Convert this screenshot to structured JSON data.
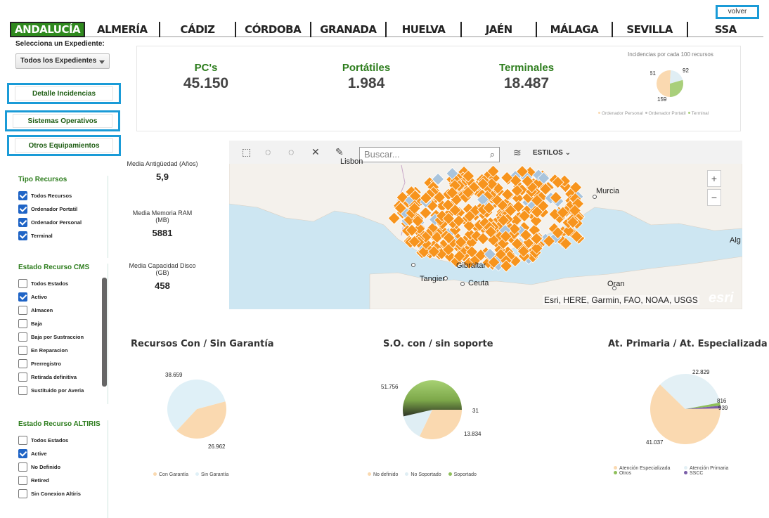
{
  "volver": "volver",
  "tabs": [
    "ANDALUCÍA",
    "ALMERÍA",
    "CÁDIZ",
    "CÓRDOBA",
    "GRANADA",
    "HUELVA",
    "JAÉN",
    "MÁLAGA",
    "SEVILLA",
    "SSA"
  ],
  "expediente": {
    "label": "Selecciona un Expediente:",
    "value": "Todos los Expedientes"
  },
  "buttons": {
    "detalle": "Detalle Incidencias",
    "sistemas": "Sistemas Operativos",
    "otros": "Otros Equipamientos"
  },
  "filters": {
    "tipo": {
      "title": "Tipo Recursos",
      "items": [
        {
          "label": "Todos Recursos",
          "checked": true
        },
        {
          "label": "Ordenador Portatil",
          "checked": true
        },
        {
          "label": "Ordenador Personal",
          "checked": true
        },
        {
          "label": "Terminal",
          "checked": true
        }
      ]
    },
    "cms": {
      "title": "Estado Recurso CMS",
      "items": [
        {
          "label": "Todos Estados",
          "checked": false
        },
        {
          "label": "Activo",
          "checked": true
        },
        {
          "label": "Almacen",
          "checked": false
        },
        {
          "label": "Baja",
          "checked": false
        },
        {
          "label": "Baja por Sustraccion",
          "checked": false
        },
        {
          "label": "En Reparacion",
          "checked": false
        },
        {
          "label": "Prerregistro",
          "checked": false
        },
        {
          "label": "Retirada definitiva",
          "checked": false
        },
        {
          "label": "Sustituido por Averia",
          "checked": false
        }
      ]
    },
    "altiris": {
      "title": "Estado Recurso ALTIRIS",
      "items": [
        {
          "label": "Todos Estados",
          "checked": false
        },
        {
          "label": "Active",
          "checked": true
        },
        {
          "label": "No Definido",
          "checked": false
        },
        {
          "label": "Retired",
          "checked": false
        },
        {
          "label": "Sin Conexion Altiris",
          "checked": false
        }
      ]
    }
  },
  "summary": {
    "pcs": {
      "label": "PC's",
      "value": "45.150"
    },
    "portatiles": {
      "label": "Portátiles",
      "value": "1.984"
    },
    "terminales": {
      "label": "Terminales",
      "value": "18.487"
    },
    "incidencias_title": "Incidencias por cada 100 recursos",
    "incidencias_legend": [
      "Ordenador Personal",
      "Ordenador Portatil",
      "Terminal"
    ]
  },
  "metrics": [
    {
      "label": "Media Antigüedad (Años)",
      "value": "5,9"
    },
    {
      "label": "Media Memoria RAM (MB)",
      "value": "5881"
    },
    {
      "label": "Media Capacidad Disco (GB)",
      "value": "458"
    }
  ],
  "map": {
    "search_placeholder": "Buscar...",
    "estilos": "ESTILOS",
    "attribution": "Esri, HERE, Garmin, FAO, NOAA, USGS",
    "logo": "esri",
    "places": [
      "Lisbon",
      "Murcia",
      "Alg",
      "Gibraltar",
      "Tangier",
      "Ceuta",
      "Oran"
    ],
    "zoom_in": "+",
    "zoom_out": "−",
    "colors": {
      "marker": "#f7941d",
      "marker_alt": "#a9c4dc",
      "sea": "#cde6f2",
      "land": "#f4f1ec"
    }
  },
  "chart_data": [
    {
      "type": "pie",
      "title": "Incidencias por cada 100 recursos",
      "categories": [
        "Ordenador Personal",
        "Ordenador Portatil",
        "Terminal"
      ],
      "values": [
        159,
        61,
        92
      ],
      "colors": [
        "#fad9b0",
        "#e0eef4",
        "#a9cf7b"
      ]
    },
    {
      "type": "pie",
      "title": "Recursos Con / Sin Garantía",
      "categories": [
        "Con Garantía",
        "Sin Garantía"
      ],
      "values": [
        26.962,
        38.659
      ],
      "labels": [
        "26.962",
        "38.659"
      ],
      "colors": [
        "#fad9b0",
        "#dff0f7"
      ]
    },
    {
      "type": "pie",
      "title": "S.O. con / sin soporte",
      "categories": [
        "No definido",
        "No Soportado",
        "Soportado"
      ],
      "values": [
        31,
        13.834,
        51.756
      ],
      "labels": [
        "31",
        "13.834",
        "51.756"
      ],
      "colors": [
        "#fad9b0",
        "#dfeef4",
        "#8fc05b"
      ]
    },
    {
      "type": "pie",
      "title": "At. Primaria / At. Especializada",
      "categories": [
        "Atención Especializada",
        "Atención Primaria",
        "Otros",
        "SSCC"
      ],
      "values": [
        41.037,
        22.829,
        0.939,
        0.816
      ],
      "labels": [
        "41.037",
        "22.829",
        "939",
        "816"
      ],
      "colors": [
        "#fad9b0",
        "#e3f0f5",
        "#8fc05b",
        "#7a5ea8"
      ]
    }
  ]
}
